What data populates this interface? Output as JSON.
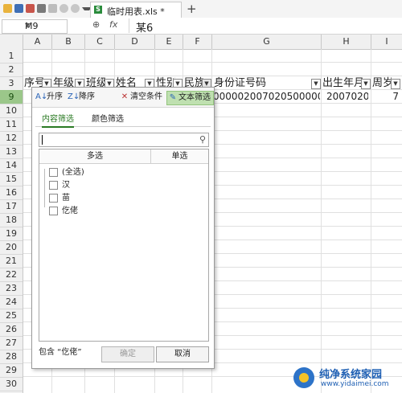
{
  "toolbar": {
    "icons": [
      "folder-icon",
      "save-icon",
      "print-preview-icon",
      "print-icon",
      "export-icon",
      "undo-icon",
      "redo-icon",
      "more-icon"
    ],
    "doc_tab": {
      "icon": "xls-icon",
      "icon_text": "S",
      "title": "临时用表.xls *"
    },
    "add_tab_label": "+"
  },
  "formula_bar": {
    "name_box": "M9",
    "zoom_icon_glyph": "⊕",
    "fx_label": "fx",
    "content": "某6"
  },
  "columns": [
    "A",
    "B",
    "C",
    "D",
    "E",
    "F",
    "G",
    "H",
    "I"
  ],
  "rows": [
    "1",
    "2",
    "3",
    "9",
    "10",
    "11",
    "12",
    "13",
    "14",
    "15",
    "16",
    "17",
    "18",
    "19",
    "20",
    "21",
    "22",
    "23",
    "24",
    "25",
    "26",
    "27",
    "28",
    "29",
    "30"
  ],
  "selected_row": "9",
  "header_row": {
    "A": "序号",
    "B": "年级",
    "C": "班级",
    "D": "姓名",
    "E": "性别",
    "F": "民族",
    "G": "身份证号码",
    "H": "出生年月",
    "I": "周岁"
  },
  "data_row": {
    "G": "000002007020500000",
    "H": "20070205",
    "I": "7"
  },
  "filter_panel": {
    "sort_asc": "升序",
    "sort_desc": "降序",
    "clear": "清空条件",
    "text_filter": "文本筛选",
    "tab_content": "内容筛选",
    "tab_color": "颜色筛选",
    "search_value": "",
    "list_header_multi": "多选",
    "list_header_single": "单选",
    "items": [
      {
        "label": "(全选)",
        "checked": false
      },
      {
        "label": "汉",
        "checked": false
      },
      {
        "label": "苗",
        "checked": false
      },
      {
        "label": "仡佬",
        "checked": false
      }
    ],
    "condition_text": "包含 “仡佬”",
    "ok_label": "确定",
    "cancel_label": "取消"
  },
  "watermark": {
    "title": "纯净系统家园",
    "url": "www.yidaimei.com"
  }
}
